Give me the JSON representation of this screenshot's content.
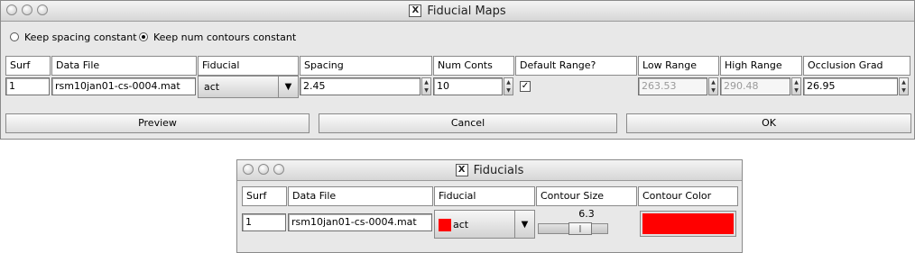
{
  "fiducial_maps": {
    "title": "Fiducial Maps",
    "x_logo": "X",
    "options": {
      "keep_spacing": "Keep spacing constant",
      "keep_num_contours": "Keep num contours constant",
      "selected": "keep_num_contours"
    },
    "headers": {
      "surf": "Surf",
      "data_file": "Data File",
      "fiducial": "Fiducial",
      "spacing": "Spacing",
      "num_conts": "Num Conts",
      "default_range": "Default Range?",
      "low_range": "Low Range",
      "high_range": "High Range",
      "occlusion_grad": "Occlusion Grad"
    },
    "row": {
      "surf": "1",
      "data_file": "rsm10jan01-cs-0004.mat",
      "fiducial": "act",
      "spacing": "2.45",
      "num_conts": "10",
      "default_range_checked": true,
      "low_range": "263.53",
      "high_range": "290.48",
      "occlusion_grad": "26.95"
    },
    "buttons": {
      "preview": "Preview",
      "cancel": "Cancel",
      "ok": "OK"
    }
  },
  "fiducials": {
    "title": "Fiducials",
    "x_logo": "X",
    "headers": {
      "surf": "Surf",
      "data_file": "Data File",
      "fiducial": "Fiducial",
      "contour_size": "Contour Size",
      "contour_color": "Contour Color"
    },
    "row": {
      "surf": "1",
      "data_file": "rsm10jan01-cs-0004.mat",
      "fiducial": "act",
      "fiducial_swatch_color": "#ff0000",
      "contour_size": "6.3",
      "contour_size_level": 0.63,
      "contour_color": "#ff0000"
    }
  }
}
